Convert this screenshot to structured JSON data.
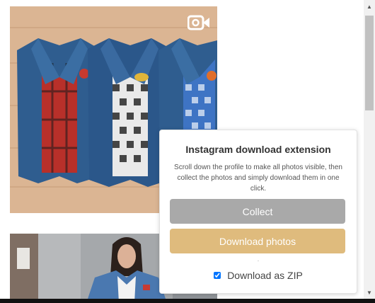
{
  "feed": {
    "post1": {
      "alt": "denim-jackets-photo",
      "video_icon": "video-camera-icon"
    },
    "post2": {
      "alt": "woman-in-denim-jacket-photo"
    }
  },
  "popup": {
    "title": "Instagram download extension",
    "description": "Scroll down the profile to make all photos visible, then collect the photos and simply download them in one click.",
    "collect_label": "Collect",
    "download_label": "Download photos",
    "separator": ".",
    "zip_label": "Download as ZIP",
    "zip_checked": true
  },
  "colors": {
    "collect": "#a9a9a9",
    "download": "#dfbb7d"
  },
  "scrollbar": {
    "up_arrow": "▲",
    "down_arrow": "▼"
  }
}
